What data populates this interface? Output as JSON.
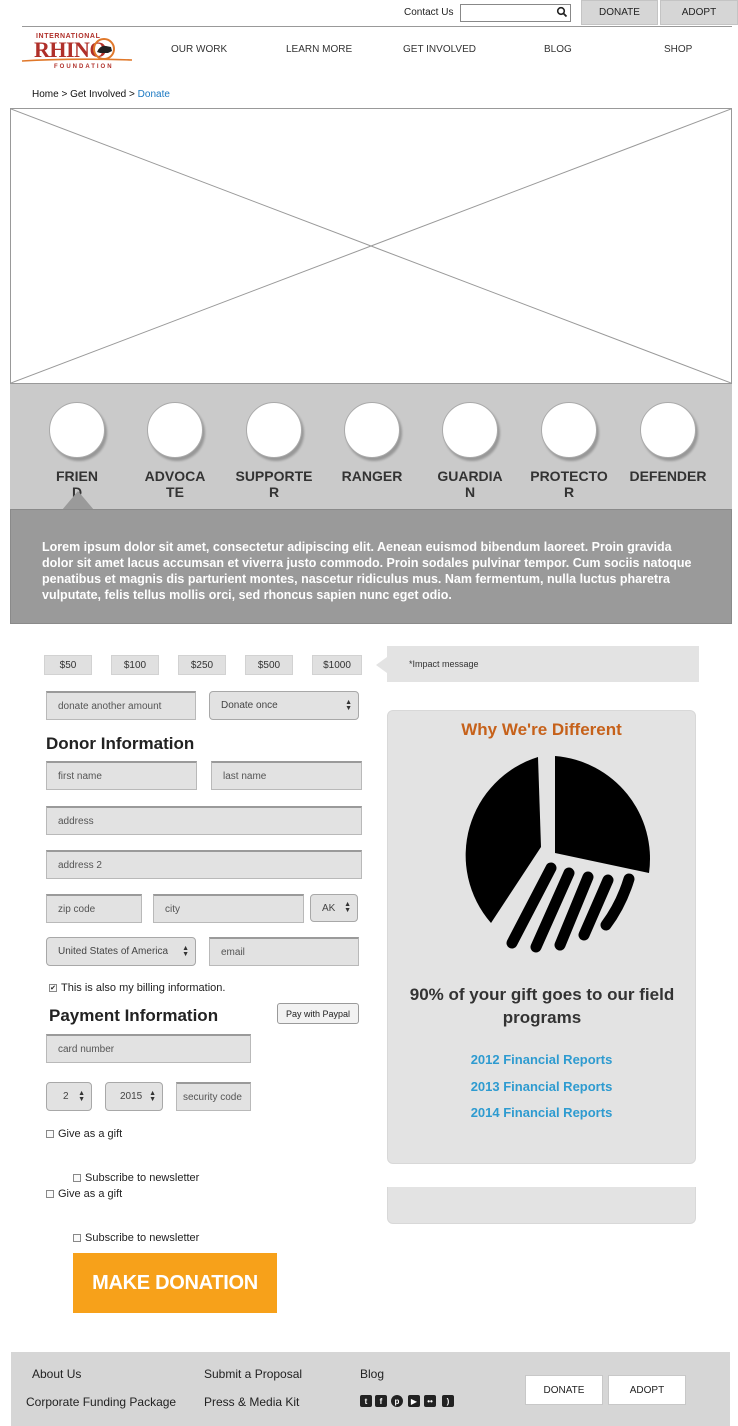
{
  "topbar": {
    "contact": "Contact Us",
    "search_placeholder": "",
    "donate": "DONATE",
    "adopt": "ADOPT"
  },
  "logo": {
    "line1": "INTERNATIONAL",
    "line2": "RHINO",
    "line3": "FOUNDATION"
  },
  "nav": [
    "OUR WORK",
    "LEARN MORE",
    "GET INVOLVED",
    "BLOG",
    "SHOP"
  ],
  "breadcrumb": {
    "home": "Home",
    "sep": ">",
    "section": "Get Involved",
    "current": "Donate"
  },
  "levels": [
    "FRIEND",
    "ADVOCATE",
    "SUPPORTER",
    "RANGER",
    "GUARDIAN",
    "PROTECTOR",
    "DEFENDER"
  ],
  "level_description": "Lorem ipsum dolor sit amet, consectetur adipiscing elit. Aenean euismod bibendum laoreet. Proin gravida dolor sit amet lacus accumsan et viverra justo commodo. Proin sodales pulvinar tempor. Cum sociis natoque penatibus et magnis dis parturient montes, nascetur ridiculus mus. Nam fermentum, nulla luctus pharetra vulputate, felis tellus mollis orci, sed rhoncus sapien nunc eget odio.",
  "amounts": [
    "$50",
    "$100",
    "$250",
    "$500",
    "$1000"
  ],
  "impact_message": "*Impact message",
  "donate_other_placeholder": "donate another amount",
  "frequency": "Donate once",
  "donor": {
    "heading": "Donor Information",
    "first_name": "first name",
    "last_name": "last name",
    "address": "address",
    "address2": "address 2",
    "zip": "zip code",
    "city": "city",
    "state": "AK",
    "country": "United States of America",
    "email": "email",
    "billing_label": "This is also my billing information.",
    "billing_checked": "✔"
  },
  "payment": {
    "heading": "Payment Information",
    "paypal": "Pay with Paypal",
    "card": "card number",
    "month": "2",
    "year": "2015",
    "security": "security code"
  },
  "options": {
    "gift": "Give as a gift",
    "newsletter": "Subscribe to newsletter"
  },
  "submit": "MAKE DONATION",
  "why": {
    "title": "Why We're Different",
    "copy": "90% of your gift goes to our field programs",
    "reports": [
      "2012 Financial Reports",
      "2013 Financial Reports",
      "2014 Financial Reports"
    ]
  },
  "footer": {
    "about": "About Us",
    "corporate": "Corporate Funding Package",
    "proposal": "Submit a Proposal",
    "press": "Press & Media Kit",
    "blog": "Blog",
    "donate": "DONATE",
    "adopt": "ADOPT",
    "social": [
      "twitter-icon",
      "facebook-icon",
      "pinterest-icon",
      "youtube-icon",
      "flickr-icon",
      "rss-icon"
    ]
  },
  "colors": {
    "accent_orange": "#f7a11a",
    "title_orange": "#c6611a",
    "link_blue": "#2e9bd0",
    "breadcrumb_blue": "#1a78c2"
  }
}
